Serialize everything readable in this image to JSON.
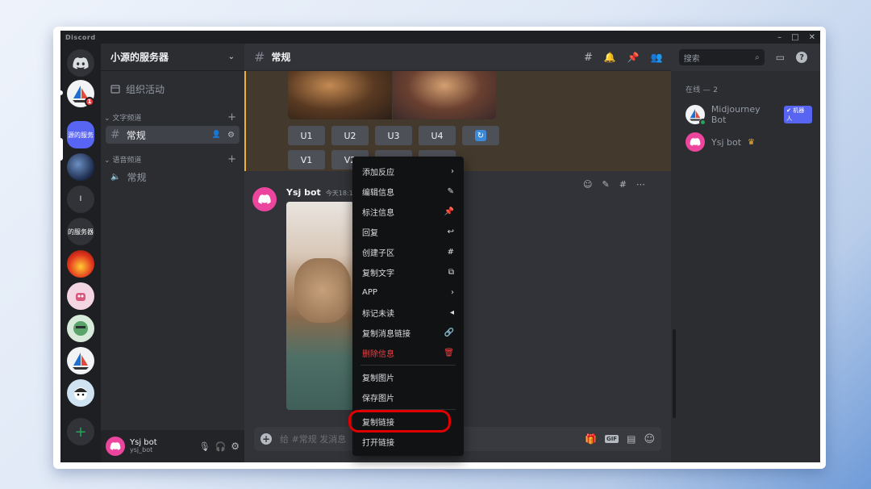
{
  "window": {
    "app_name": "Discord",
    "controls": [
      "–",
      "□",
      "✕"
    ]
  },
  "server": {
    "name": "小源的服务器",
    "events_label": "组织活动",
    "text_category": "文字频道",
    "voice_category": "语音频道",
    "text_channel": "常规",
    "voice_channel": "常规"
  },
  "rail": {
    "badge_count": "1",
    "selected_server_label": "源的服务",
    "server_i_label": "I",
    "server_text_label": "的服务器",
    "add_label": "+"
  },
  "user": {
    "name": "Ysj bot",
    "handle": "ysj_bot"
  },
  "channel_header": {
    "name": "常规",
    "search_placeholder": "搜索"
  },
  "midjourney_buttons": {
    "row1": [
      "U1",
      "U2",
      "U3",
      "U4"
    ],
    "row2": [
      "V1",
      "V2"
    ]
  },
  "message": {
    "author": "Ysj bot",
    "timestamp": "今天18:10"
  },
  "composer": {
    "placeholder": "给 #常规 发消息"
  },
  "members": {
    "online_header": "在线 — 2",
    "list": [
      {
        "name": "Midjourney Bot",
        "tag": "✔ 机器人"
      },
      {
        "name": "Ysj bot",
        "crown": "♛"
      }
    ]
  },
  "context_menu": {
    "items": [
      {
        "label": "添加反应",
        "icon": "chevron-right"
      },
      {
        "label": "编辑信息",
        "icon": "pencil"
      },
      {
        "label": "标注信息",
        "icon": "pin"
      },
      {
        "label": "回复",
        "icon": "reply"
      },
      {
        "label": "创建子区",
        "icon": "thread"
      },
      {
        "label": "复制文字",
        "icon": "copy"
      },
      {
        "label": "APP",
        "icon": "chevron-right"
      },
      {
        "label": "标记未读",
        "icon": "unread"
      },
      {
        "label": "复制消息链接",
        "icon": "link"
      },
      {
        "label": "删除信息",
        "icon": "trash"
      },
      {
        "label": "复制图片",
        "icon": ""
      },
      {
        "label": "保存图片",
        "icon": ""
      },
      {
        "label": "复制链接",
        "icon": ""
      },
      {
        "label": "打开链接",
        "icon": ""
      }
    ],
    "highlighted_item": "复制链接",
    "danger_color": "#f23f43",
    "highlight_ring_color": "#e00000"
  },
  "colors": {
    "blurple": "#5865f2",
    "online": "#23a55a",
    "mention_bar": "#f0b232"
  }
}
